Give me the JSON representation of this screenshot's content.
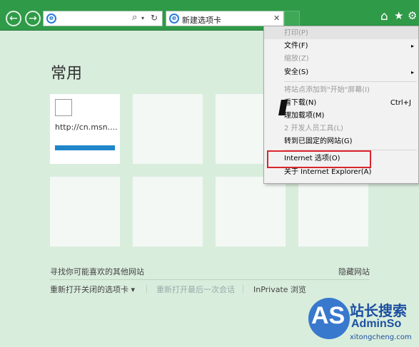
{
  "toolbar": {
    "back_icon": "back-arrow-icon",
    "forward_icon": "forward-arrow-icon",
    "address_value": "",
    "search_glyph": "⌕",
    "refresh_glyph": "↻",
    "close_glyph": "✕",
    "tab_title": "新建选项卡",
    "home_glyph": "⌂",
    "fav_glyph": "★",
    "gear_glyph": "⚙"
  },
  "page": {
    "heading": "常用",
    "tile1_url": "http://cn.msn....",
    "find_more": "寻找你可能喜欢的其他网站",
    "hide_sites": "隐藏网站",
    "reopen_closed": "重新打开关闭的选项卡 ▾",
    "reopen_last": "重新打开最后一次会话",
    "inprivate": "InPrivate 浏览"
  },
  "menu": {
    "items": [
      {
        "label": "打印(P)",
        "shortcut": "",
        "arrow": "▸"
      },
      {
        "label": "文件(F)",
        "shortcut": "",
        "arrow": "▸"
      },
      {
        "label": "缩放(Z)",
        "shortcut": "",
        "arrow": ""
      },
      {
        "label": "安全(S)",
        "shortcut": "",
        "arrow": "▸"
      },
      {
        "label": "将站点添加到\"开始\"屏幕(I)",
        "shortcut": "",
        "arrow": ""
      },
      {
        "label": "看下载(N)",
        "shortcut": "Ctrl+J",
        "arrow": ""
      },
      {
        "label": "理加载项(M)",
        "shortcut": "",
        "arrow": ""
      },
      {
        "label": "2 开发人员工具(L)",
        "shortcut": "",
        "arrow": ""
      },
      {
        "label": "转到已固定的网站(G)",
        "shortcut": "",
        "arrow": ""
      },
      {
        "label": "Internet 选项(O)",
        "shortcut": "",
        "arrow": ""
      },
      {
        "label": "关于 Internet Explorer(A)",
        "shortcut": "",
        "arrow": ""
      }
    ]
  },
  "watermark": {
    "as": "AS",
    "title": "站长搜索",
    "admin": "AdminSo",
    "domain": "xitongcheng.com"
  },
  "colors": {
    "toolbar_bg": "#2f9a47",
    "page_bg": "#d9eddd",
    "highlight_border": "#d9262d",
    "progress_bar": "#1f86c9"
  }
}
